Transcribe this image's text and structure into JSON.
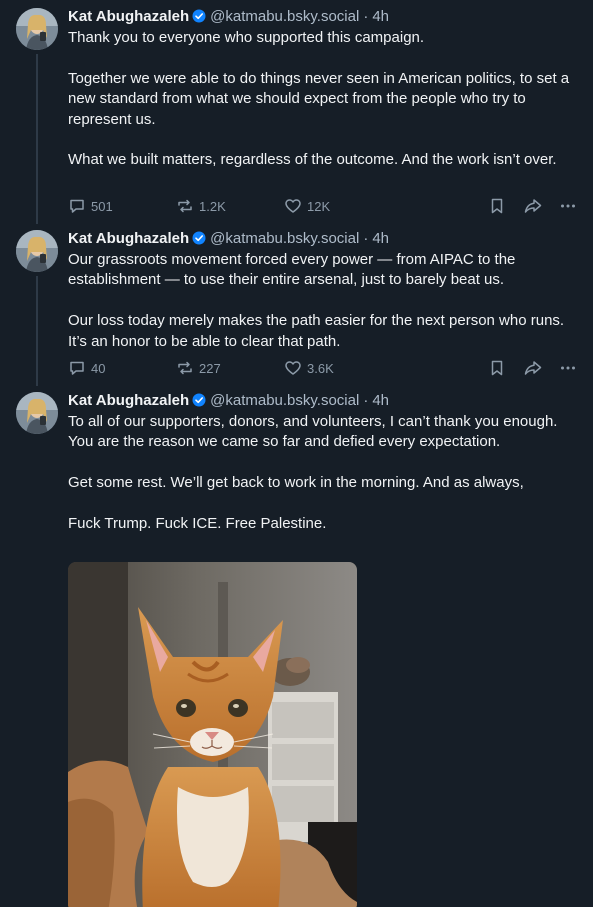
{
  "posts": [
    {
      "author": "Kat Abughazaleh",
      "handle": "@katmabu.bsky.social",
      "separator": "·",
      "time": "4h",
      "paragraphs": [
        "Thank you to everyone who supported this campaign.",
        "Together we were able to do things never seen in American politics, to set a new standard from what we should expect from the people who try to represent us.",
        "What we built matters, regardless of the outcome. And the work isn’t over."
      ],
      "replies": "501",
      "reposts": "1.2K",
      "likes": "12K"
    },
    {
      "author": "Kat Abughazaleh",
      "handle": "@katmabu.bsky.social",
      "separator": "·",
      "time": "4h",
      "paragraphs": [
        "Our grassroots movement forced every power — from AIPAC to the establishment — to use their entire arsenal, just to barely beat us.",
        "Our loss today merely makes the path easier for the next person who runs. It’s an honor to be able to clear that path."
      ],
      "replies": "40",
      "reposts": "227",
      "likes": "3.6K"
    },
    {
      "author": "Kat Abughazaleh",
      "handle": "@katmabu.bsky.social",
      "separator": "·",
      "time": "4h",
      "paragraphs": [
        "To all of our supporters, donors, and volunteers, I can’t thank you enough. You are the reason we came so far and defied every expectation.",
        "Get some rest. We’ll get back to work in the morning. And as always,",
        "Fuck Trump. Fuck ICE. Free Palestine."
      ],
      "media": "orange-cat-photo"
    }
  ],
  "icons": {
    "reply": "reply-icon",
    "repost": "repost-icon",
    "like": "heart-icon",
    "bookmark": "bookmark-icon",
    "share": "share-icon",
    "more": "more-icon",
    "verified": "verified-badge-icon"
  },
  "colors": {
    "background": "#161e27",
    "text": "#f1f3f5",
    "muted": "#aebbc9",
    "action": "#8c9aa8",
    "verified": "#1083fe",
    "thread_line": "#2e3a47"
  }
}
